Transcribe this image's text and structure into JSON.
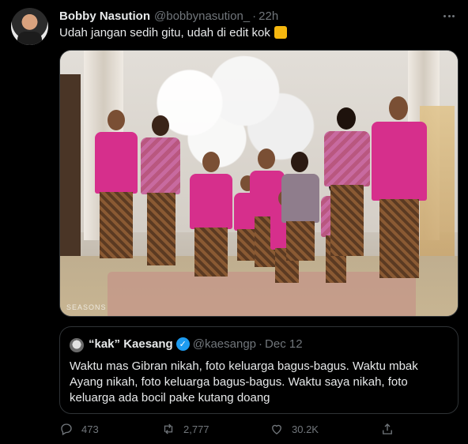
{
  "tweet": {
    "author_name": "Bobby Nasution",
    "author_handle": "@bobbynasution_",
    "separator": "·",
    "time": "22h",
    "text": "Udah jangan sedih gitu, udah di edit kok",
    "emoji": "thumbs-up-emoji"
  },
  "photo": {
    "watermark": "SEASONS"
  },
  "quote": {
    "author_name": "“kak” Kaesang",
    "verified_icon": "verified-badge-icon",
    "author_handle": "@kaesangp",
    "separator": "·",
    "date": "Dec 12",
    "text": "Waktu mas Gibran nikah, foto keluarga bagus-bagus. Waktu mbak Ayang nikah, foto keluarga bagus-bagus. Waktu saya nikah, foto keluarga ada bocil pake kutang doang"
  },
  "actions": {
    "replies": "473",
    "retweets": "2,777",
    "likes": "30.2K"
  },
  "colors": {
    "background": "#000000",
    "text_primary": "#e7e9ea",
    "text_secondary": "#71767b",
    "border": "#2f3336",
    "verified": "#1d9bf0"
  }
}
